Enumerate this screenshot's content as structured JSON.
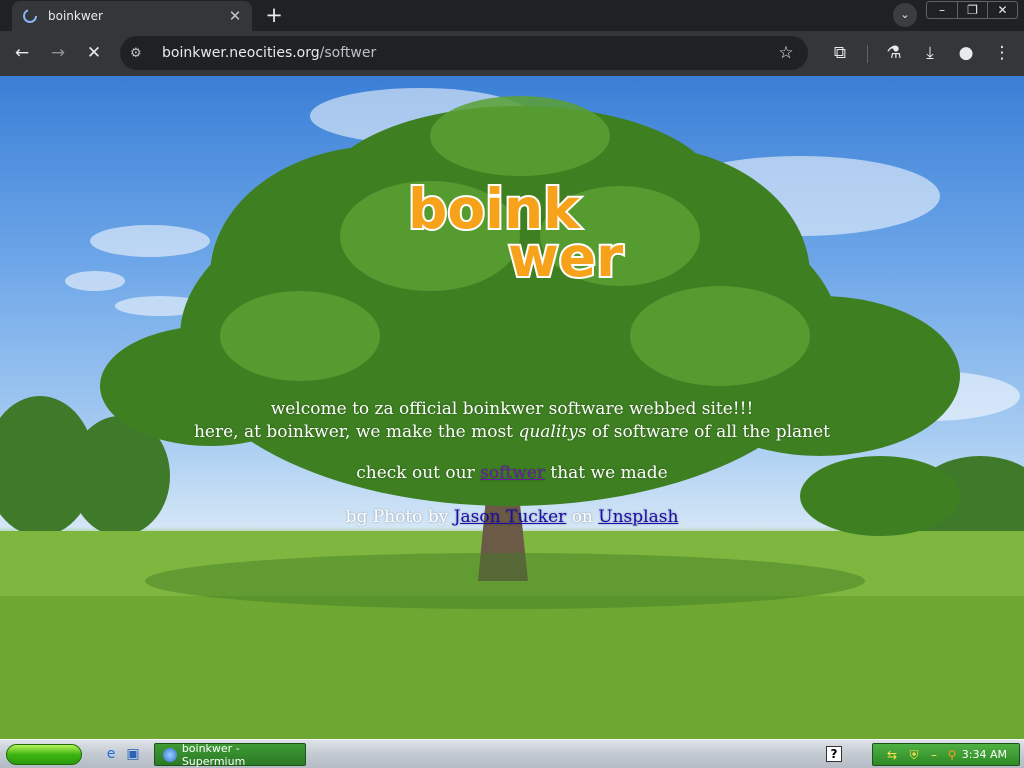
{
  "browser": {
    "tab": {
      "title": "boinkwer"
    },
    "url": {
      "host": "boinkwer.neocities.org",
      "path": "/softwer"
    }
  },
  "page": {
    "logo": {
      "line1": "boink",
      "line2": "wer"
    },
    "welcome_line1": "welcome to za official boinkwer software webbed site!!!",
    "welcome_line2_before": "here, at boinkwer, we make the most",
    "welcome_line2_emphasis": "qualitys",
    "welcome_line2_after": "of software of all the planet",
    "checkout_before": "check out our",
    "checkout_link": "softwer",
    "checkout_after": "that we made",
    "credit_before": "bg Photo by",
    "credit_author": "Jason Tucker",
    "credit_middle": "on",
    "credit_site": "Unsplash"
  },
  "taskbar": {
    "window_title": "boinkwer - Supermium",
    "clock": "3:34 AM"
  },
  "colors": {
    "logo_orange": "#f7a21b",
    "link_blue": "#1a0dab",
    "link_visited": "#681da8"
  },
  "icons": [
    "back-arrow-icon",
    "forward-arrow-icon",
    "stop-loading-icon",
    "site-info-icon",
    "bookmark-star-icon",
    "extensions-icon",
    "labs-flask-icon",
    "downloads-icon",
    "profile-icon",
    "menu-kebab-icon"
  ]
}
